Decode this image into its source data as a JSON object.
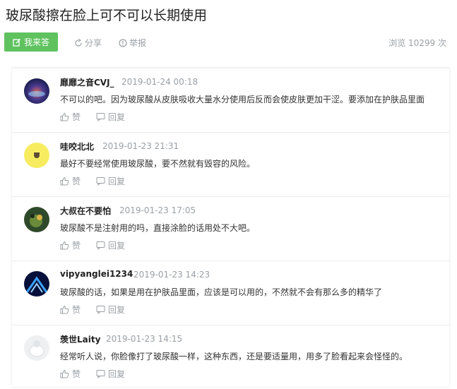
{
  "page": {
    "title": "玻尿酸擦在脸上可不可以长期使用"
  },
  "actions": {
    "answer_label": "我来答",
    "share_label": "分享",
    "report_label": "举报",
    "views_text": "浏览 10299 次"
  },
  "comments": [
    {
      "username": "靡靡之音CVJ_",
      "time": "2019-01-24 00:18",
      "text": "不可以的吧。因为玻尿酸从皮肤吸收大量水分使用后反而会使皮肤更加干涩。要添加在护肤品里面",
      "like_label": "赞",
      "reply_label": "回复"
    },
    {
      "username": "哇咬北北",
      "time": "2019-01-23 21:31",
      "text": "最好不要经常使用玻尿酸，要不然就有毁容的风险。",
      "like_label": "赞",
      "reply_label": "回复"
    },
    {
      "username": "大叔在不要怕",
      "time": "2019-01-23 17:05",
      "text": "玻尿酸不是注射用的吗，直接涂脸的话用处不大吧。",
      "like_label": "赞",
      "reply_label": "回复"
    },
    {
      "username": "vipyanglei1234",
      "time": "2019-01-23 14:23",
      "text": "玻尿酸的话，如果是用在护肤品里面，应该是可以用的，不然就不会有那么多的精华了",
      "like_label": "赞",
      "reply_label": "回复"
    },
    {
      "username": "羡世Laity",
      "time": "2019-01-23 14:15",
      "text": "经常听人说，你脸像打了玻尿酸一样，这种东西，还是要适量用，用多了脸看起来会怪怪的。",
      "like_label": "赞",
      "reply_label": "回复"
    }
  ],
  "colors": {
    "accent_green": "#5fc25f",
    "muted_gray": "#9aa0a6"
  }
}
